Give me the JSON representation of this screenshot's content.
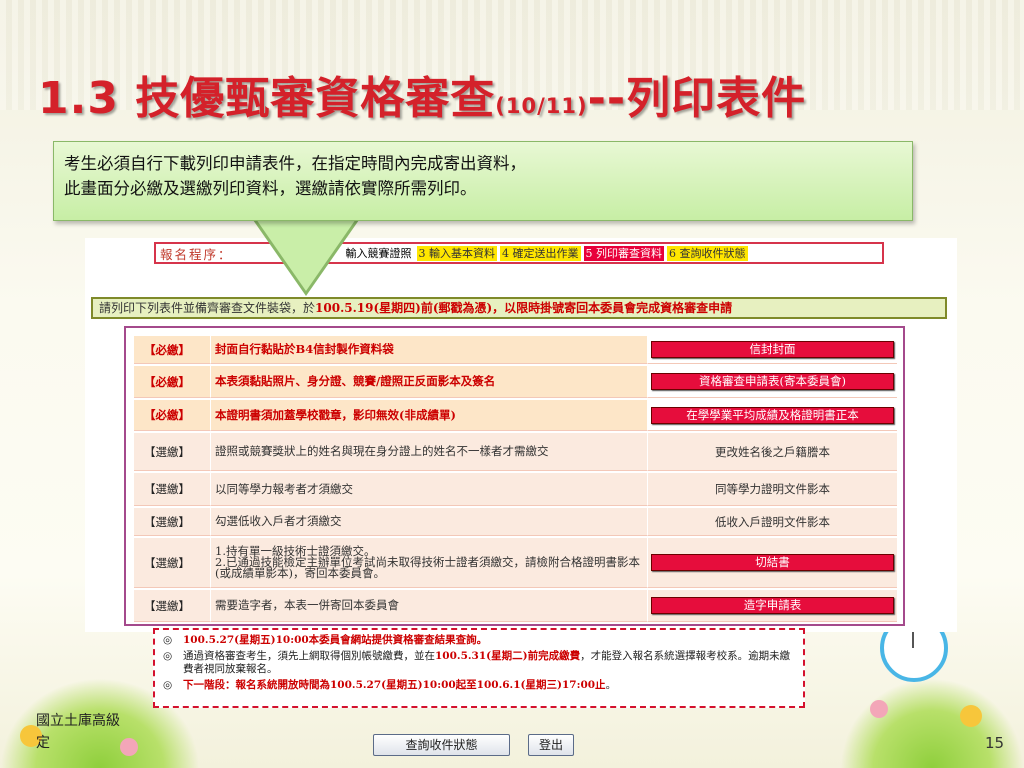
{
  "slide": {
    "title_main": "1.3 技優甄審資格審查",
    "title_date": "(10/11)",
    "title_tail": "--列印表件",
    "callout_line1": "考生必須自行下載列印申請表件，在指定時間內完成寄出資料，",
    "callout_line2": "此畫面分必繳及選繳列印資料，選繳請依實際所需列印。",
    "footer_line1": "國立土庫高級",
    "footer_line2": "定",
    "page_number": "15"
  },
  "steps": {
    "label": "報名程序：",
    "items": [
      {
        "label": "輸入競賽證照",
        "style": "plain"
      },
      {
        "label": "3 輸入基本資料",
        "style": "yellow"
      },
      {
        "label": "4 確定送出作業",
        "style": "yellow"
      },
      {
        "label": "5 列印審查資料",
        "style": "red"
      },
      {
        "label": "6 查詢收件狀態",
        "style": "yellow"
      }
    ]
  },
  "notice": {
    "prefix": "請列印下列表件並備齊審查文件裝袋，於",
    "emphasis": "100.5.19(星期四)前(郵戳為憑)，以限時掛號寄回本委員會完成資格審查申請"
  },
  "table": {
    "rows": [
      {
        "type": "必繳",
        "type_label": "【必繳】",
        "desc": "封面自行黏貼於B4信封製作資料袋",
        "action": "信封封面",
        "action_style": "button"
      },
      {
        "type": "必繳",
        "type_label": "【必繳】",
        "desc": "本表須黏貼照片、身分證、競賽/證照正反面影本及簽名",
        "action": "資格審查申請表(寄本委員會)",
        "action_style": "button"
      },
      {
        "type": "必繳",
        "type_label": "【必繳】",
        "desc": "本證明書須加蓋學校戳章，影印無效(非成績單)",
        "action": "在學學業平均成績及格證明書正本",
        "action_style": "button"
      },
      {
        "type": "選繳",
        "type_label": "【選繳】",
        "desc": "證照或競賽獎狀上的姓名與現在身分證上的姓名不一樣者才需繳交",
        "action": "更改姓名後之戶籍謄本",
        "action_style": "link"
      },
      {
        "type": "選繳",
        "type_label": "【選繳】",
        "desc": "以同等學力報考者才須繳交",
        "action": "同等學力證明文件影本",
        "action_style": "link"
      },
      {
        "type": "選繳",
        "type_label": "【選繳】",
        "desc": "勾選低收入戶者才須繳交",
        "action": "低收入戶證明文件影本",
        "action_style": "link"
      },
      {
        "type": "選繳",
        "type_label": "【選繳】",
        "desc": "1.持有單一級技術士證須繳交。\n2.已通過技能檢定主辦單位考試尚未取得技術士證者須繳交，請檢附合格證明書影本(或成績單影本)，寄回本委員會。",
        "action": "切結書",
        "action_style": "button"
      },
      {
        "type": "選繳",
        "type_label": "【選繳】",
        "desc": "需要造字者，本表一併寄回本委員會",
        "action": "造字申請表",
        "action_style": "button"
      }
    ]
  },
  "bottom": {
    "marker": "◎",
    "line1": "100.5.27(星期五)10:00本委員會網站提供資格審查結果查詢。",
    "line2_a": "通過資格審查考生，須先上網取得個別帳號繳費，並在",
    "line2_b": "100.5.31(星期二)前完成繳費",
    "line2_c": "，才能登入報名系統選擇報考校系。逾期未繳費者視同放棄報名。",
    "line3_a": "下一階段：報名系統開放時間為",
    "line3_b": "100.5.27(星期五)10:00起至100.6.1(星期三)17:00止",
    "line3_c": "。"
  },
  "buttons": {
    "query": "查詢收件狀態",
    "logout": "登出"
  }
}
